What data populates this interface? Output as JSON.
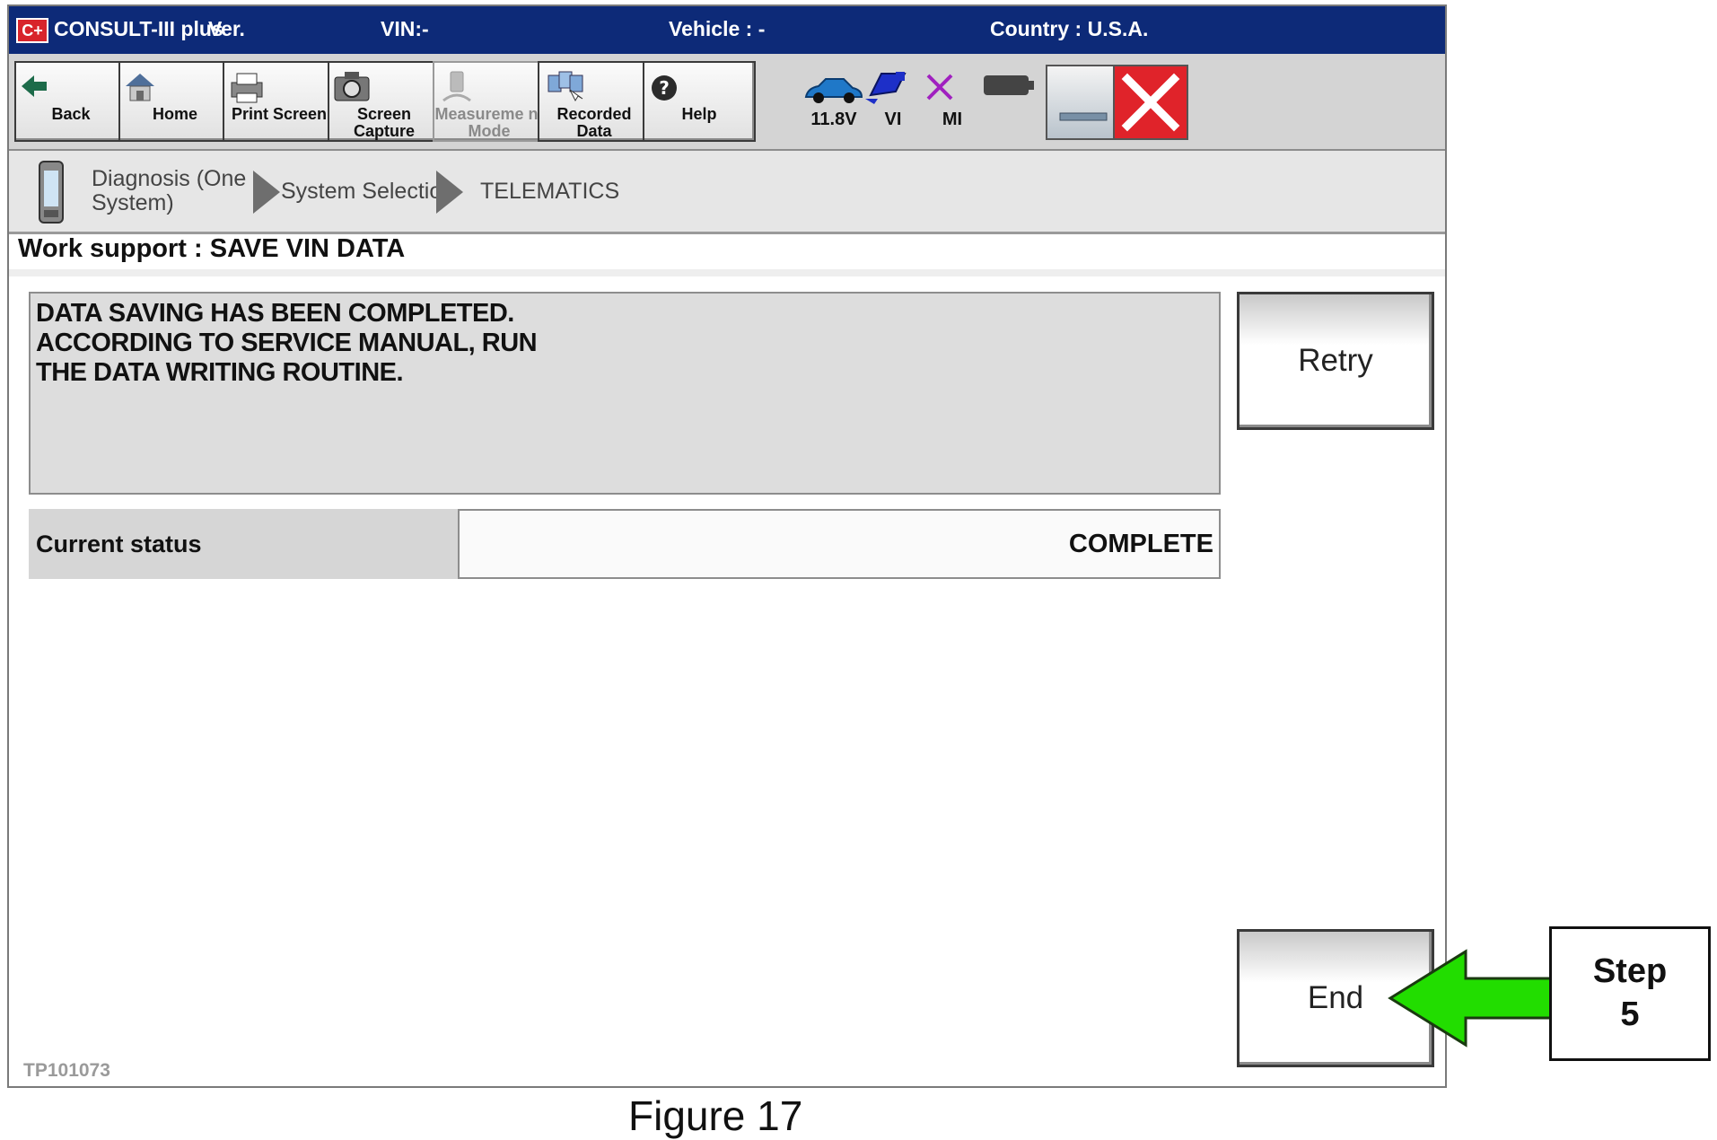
{
  "titlebar": {
    "logo": "C+",
    "app": "CONSULT-III plus",
    "ver": "Ver.",
    "vin": "VIN:-",
    "vehicle": "Vehicle : -",
    "country": "Country : U.S.A."
  },
  "toolbar": {
    "back": "Back",
    "home": "Home",
    "print_screen": "Print Screen",
    "screen_capture": "Screen Capture",
    "measurement_mode": "Measureme nt Mode",
    "recorded_data": "Recorded Data",
    "help": "Help"
  },
  "status_icons": {
    "voltage": "11.8V",
    "vi": "VI",
    "mi": "MI"
  },
  "breadcrumb": {
    "item1": "Diagnosis (One System)",
    "item1_line1": "Diagnosis (One",
    "item1_line2": "System)",
    "item2": "System Selection",
    "item3": "TELEMATICS"
  },
  "section_title": "Work support : SAVE VIN DATA",
  "message": {
    "line1": "DATA SAVING HAS BEEN COMPLETED.",
    "line2": "ACCORDING TO SERVICE MANUAL, RUN",
    "line3": "THE DATA WRITING ROUTINE."
  },
  "status": {
    "label": "Current status",
    "value": "COMPLETE"
  },
  "buttons": {
    "retry": "Retry",
    "end": "End"
  },
  "doc_id": "TP101073",
  "annotation": {
    "step_word": "Step",
    "step_number": "5",
    "arrow_color": "#22dd00"
  },
  "figure_caption": "Figure 17",
  "colors": {
    "titlebar": "#0d2a78",
    "close_button": "#e0232a",
    "mi_mark": "#a020c0"
  }
}
